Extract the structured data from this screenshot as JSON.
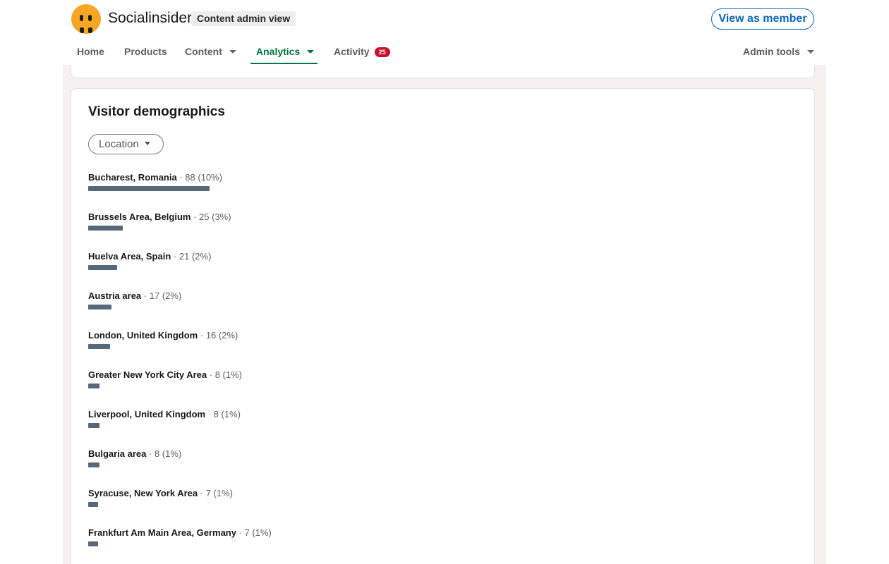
{
  "header": {
    "brand": "Socialinsider",
    "badge": "Content admin view",
    "view_as_member": "View as member"
  },
  "nav": {
    "home": "Home",
    "products": "Products",
    "content": "Content",
    "analytics": "Analytics",
    "activity": "Activity",
    "activity_count": "25",
    "admin_tools": "Admin tools"
  },
  "demographics": {
    "title": "Visitor demographics",
    "filter_label": "Location",
    "bar_color": "#56687a",
    "rows": [
      {
        "name": "Bucharest, Romania",
        "count": "88",
        "pct": "(10%)",
        "value": 88
      },
      {
        "name": "Brussels Area, Belgium",
        "count": "25",
        "pct": "(3%)",
        "value": 25
      },
      {
        "name": "Huelva Area, Spain",
        "count": "21",
        "pct": "(2%)",
        "value": 21
      },
      {
        "name": "Austria area",
        "count": "17",
        "pct": "(2%)",
        "value": 17
      },
      {
        "name": "London, United Kingdom",
        "count": "16",
        "pct": "(2%)",
        "value": 16
      },
      {
        "name": "Greater New York City Area",
        "count": "8",
        "pct": "(1%)",
        "value": 8
      },
      {
        "name": "Liverpool, United Kingdom",
        "count": "8",
        "pct": "(1%)",
        "value": 8
      },
      {
        "name": "Bulgaria area",
        "count": "8",
        "pct": "(1%)",
        "value": 8
      },
      {
        "name": "Syracuse, New York Area",
        "count": "7",
        "pct": "(1%)",
        "value": 7
      },
      {
        "name": "Frankfurt Am Main Area, Germany",
        "count": "7",
        "pct": "(1%)",
        "value": 7
      }
    ]
  },
  "colors": {
    "accent_green": "#057642",
    "member_blue": "#0a66c2",
    "badge_red": "#cb112d",
    "logo_orange": "#f5a623"
  }
}
